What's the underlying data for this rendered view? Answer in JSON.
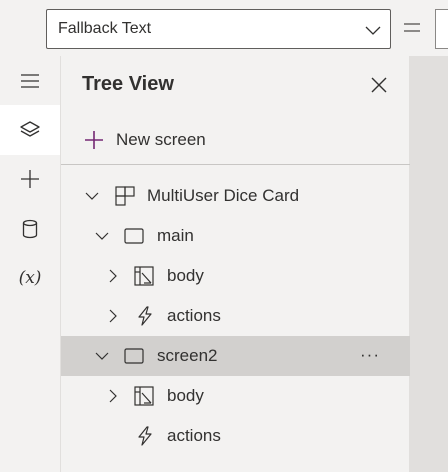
{
  "formula_bar": {
    "property_value": "Fallback Text",
    "equals_symbol": "="
  },
  "rail": {
    "items": [
      {
        "name": "menu",
        "icon": "hamburger-icon",
        "active": false
      },
      {
        "name": "tree-view",
        "icon": "layers-icon",
        "active": true
      },
      {
        "name": "insert",
        "icon": "plus-icon",
        "active": false
      },
      {
        "name": "data",
        "icon": "database-icon",
        "active": false
      },
      {
        "name": "variables",
        "icon": "variables-icon",
        "label": "(x)",
        "active": false
      }
    ]
  },
  "tree_view": {
    "title": "Tree View",
    "new_screen_label": "New screen",
    "nodes": [
      {
        "label": "MultiUser Dice Card",
        "icon": "component-icon",
        "level": 0,
        "expanded": true,
        "has_children": true
      },
      {
        "label": "main",
        "icon": "screen-icon",
        "level": 1,
        "expanded": true,
        "has_children": true
      },
      {
        "label": "body",
        "icon": "section-icon",
        "level": 2,
        "expanded": false,
        "has_children": true
      },
      {
        "label": "actions",
        "icon": "lightning-icon",
        "level": 2,
        "expanded": false,
        "has_children": true
      },
      {
        "label": "screen2",
        "icon": "screen-icon",
        "level": 1,
        "expanded": true,
        "has_children": true,
        "selected": true,
        "more_label": "···"
      },
      {
        "label": "body",
        "icon": "section-icon",
        "level": 2,
        "expanded": false,
        "has_children": true
      },
      {
        "label": "actions",
        "icon": "lightning-icon",
        "level": 2,
        "expanded": false,
        "has_children": false
      }
    ]
  },
  "colors": {
    "accent": "#742774",
    "selected_row": "#d2d0ce",
    "panel_bg": "#f3f2f1",
    "canvas_bg": "#e1dfdd"
  }
}
